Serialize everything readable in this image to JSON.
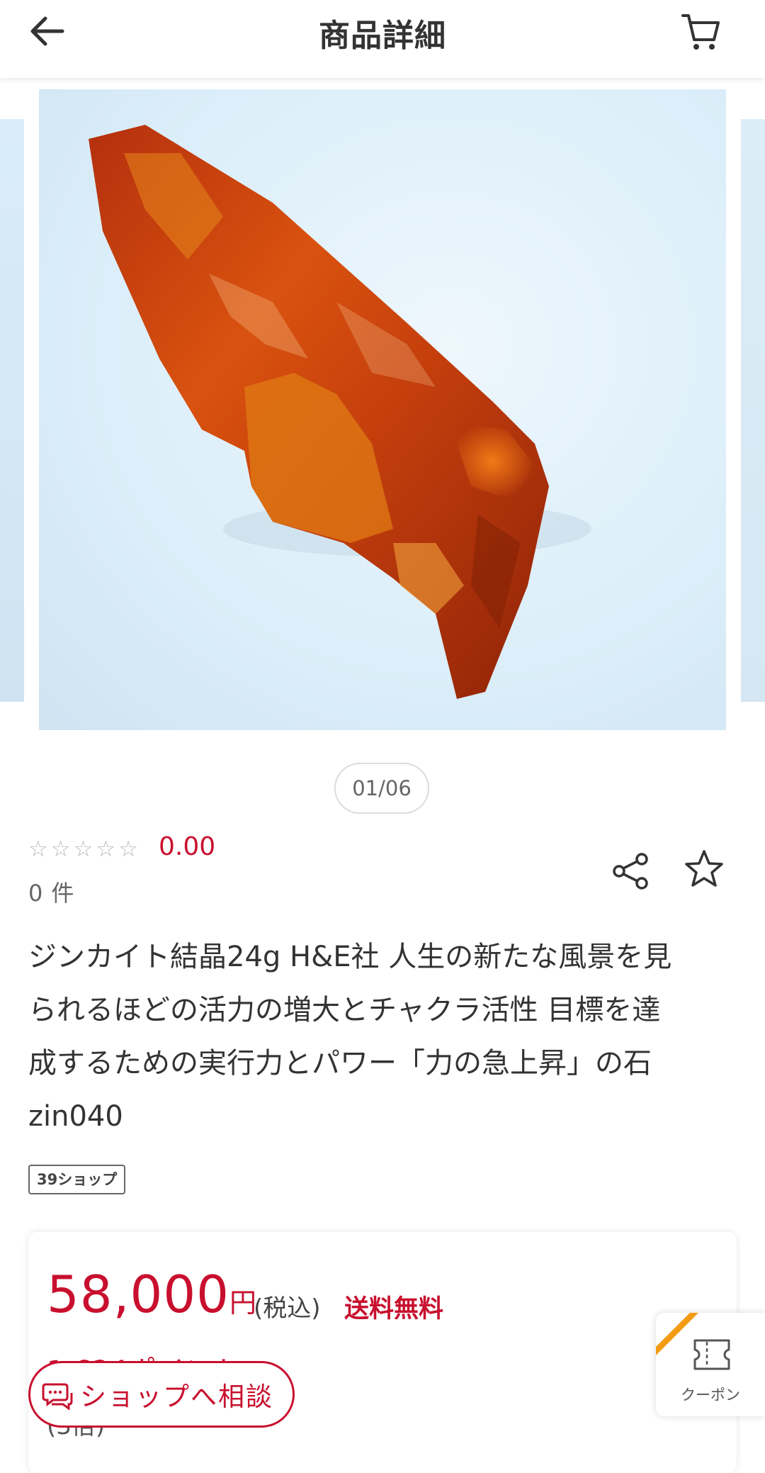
{
  "header": {
    "title": "商品詳細",
    "back_icon": "arrow-left-icon",
    "cart_icon": "cart-icon"
  },
  "carousel": {
    "counter": "01/06",
    "image_subject": "orange-zincite-crystal"
  },
  "rating": {
    "stars": 0,
    "max_stars": 5,
    "score": "0.00",
    "review_count": "0",
    "review_unit": "件"
  },
  "actions": {
    "share_icon": "share-icon",
    "favorite_icon": "star-outline-icon"
  },
  "product": {
    "title_lines": [
      "ジンカイト結晶24g H&E社 人生の新たな風景を見",
      "られるほどの活力の増大とチャクラ活性 目標を達",
      "成するための実行力とパワー「力の急上昇」の石",
      "zin040"
    ],
    "shop_tag": "39ショップ"
  },
  "price": {
    "amount": "58,000",
    "unit": "円",
    "tax": "(税込)",
    "shipping": "送料無料",
    "points": "1,624ポイント",
    "points_sub": "(3倍)"
  },
  "consult_button": {
    "label": "ショップへ相談"
  },
  "coupon": {
    "label": "クーポン"
  },
  "colors": {
    "accent": "#c8102e",
    "ribbon": "#f39c12"
  }
}
